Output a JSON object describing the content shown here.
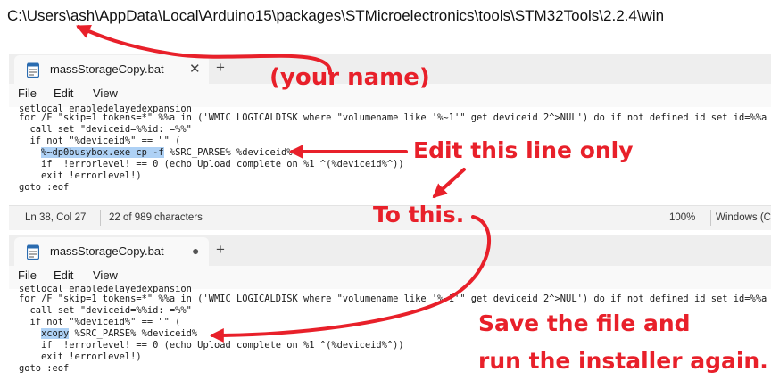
{
  "path_bar": {
    "path": "C:\\Users\\ash\\AppData\\Local\\Arduino15\\packages\\STMicroelectronics\\tools\\STM32Tools\\2.2.4\\win"
  },
  "window1": {
    "tab_title": "massStorageCopy.bat",
    "close_glyph": "✕",
    "new_tab_glyph": "+",
    "menu": [
      "File",
      "Edit",
      "View"
    ],
    "code": {
      "line0": "setlocal enabledelayedexpansion",
      "line1": "for /F \"skip=1 tokens=*\" %%a in ('WMIC LOGICALDISK where \"volumename like '%~1'\" get deviceid 2^>NUL') do if not defined id set id=%%a",
      "line2": "  call set \"deviceid=%%id: =%%\"",
      "line3": "  if not \"%deviceid%\" == \"\" (",
      "line4_highlight": "%~dp0busybox.exe cp -f",
      "line4_rest": " %SRC_PARSE% %deviceid%",
      "line5": "    if  !errorlevel! == 0 (echo Upload complete on %1 ^(%deviceid%^))",
      "line6": "    exit !errorlevel!)",
      "line7": "goto :eof"
    },
    "status": {
      "position": "Ln 38, Col 27",
      "chars": "22 of 989 characters",
      "zoom": "100%",
      "eol": "Windows (CRLF)"
    }
  },
  "window2": {
    "tab_title": "massStorageCopy.bat",
    "modified_glyph": "●",
    "new_tab_glyph": "+",
    "menu": [
      "File",
      "Edit",
      "View"
    ],
    "code": {
      "line0": "setlocal enabledelayedexpansion",
      "line1": "for /F \"skip=1 tokens=*\" %%a in ('WMIC LOGICALDISK where \"volumename like '%~1'\" get deviceid 2^>NUL') do if not defined id set id=%%a",
      "line2": "  call set \"deviceid=%%id: =%%\"",
      "line3": "  if not \"%deviceid%\" == \"\" (",
      "line4_highlight": "xcopy",
      "line4_rest": " %SRC_PARSE% %deviceid%",
      "line5": "    if  !errorlevel! == 0 (echo Upload complete on %1 ^(%deviceid%^))",
      "line6": "    exit !errorlevel!)",
      "line7": "goto :eof"
    }
  },
  "annotations": {
    "your_name": "(your name)",
    "edit_line": "Edit this line only",
    "to_this": "To this.",
    "save_line1": "Save the file and",
    "save_line2": "run the installer again.",
    "color": "#e8202a"
  },
  "colors": {
    "selection": "#aed1f5",
    "tab_strip": "#eeeeee",
    "status_bar": "#f3f3f3"
  }
}
